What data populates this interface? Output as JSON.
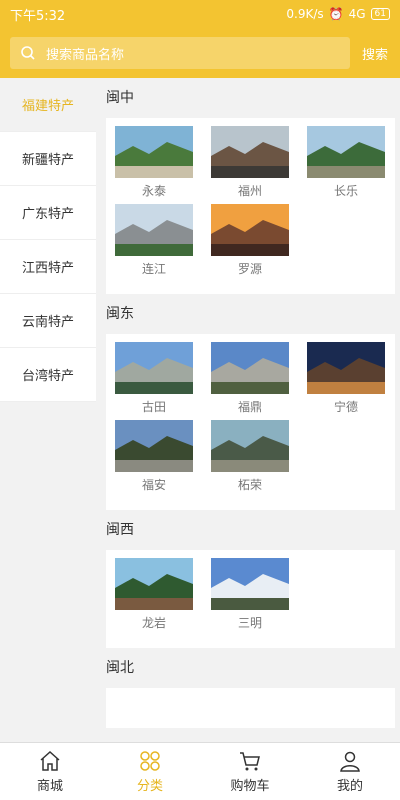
{
  "status": {
    "time": "下午5:32",
    "net": "0.9K/s",
    "signal": "4G",
    "battery": "61"
  },
  "search": {
    "placeholder": "搜索商品名称",
    "button": "搜索"
  },
  "sidebar": {
    "items": [
      {
        "label": "福建特产",
        "active": true
      },
      {
        "label": "新疆特产"
      },
      {
        "label": "广东特产"
      },
      {
        "label": "江西特产"
      },
      {
        "label": "云南特产"
      },
      {
        "label": "台湾特产"
      }
    ]
  },
  "sections": [
    {
      "title": "闽中",
      "cities": [
        "永泰",
        "福州",
        "长乐",
        "连江",
        "罗源"
      ]
    },
    {
      "title": "闽东",
      "cities": [
        "古田",
        "福鼎",
        "宁德",
        "福安",
        "柘荣"
      ]
    },
    {
      "title": "闽西",
      "cities": [
        "龙岩",
        "三明"
      ]
    },
    {
      "title": "闽北",
      "cities": []
    }
  ],
  "tabbar": {
    "items": [
      {
        "label": "商城",
        "icon": "home-icon"
      },
      {
        "label": "分类",
        "icon": "category-icon",
        "active": true
      },
      {
        "label": "购物车",
        "icon": "cart-icon"
      },
      {
        "label": "我的",
        "icon": "user-icon"
      }
    ]
  },
  "colors": {
    "brand": "#f3c431",
    "accent": "#e6b520"
  }
}
